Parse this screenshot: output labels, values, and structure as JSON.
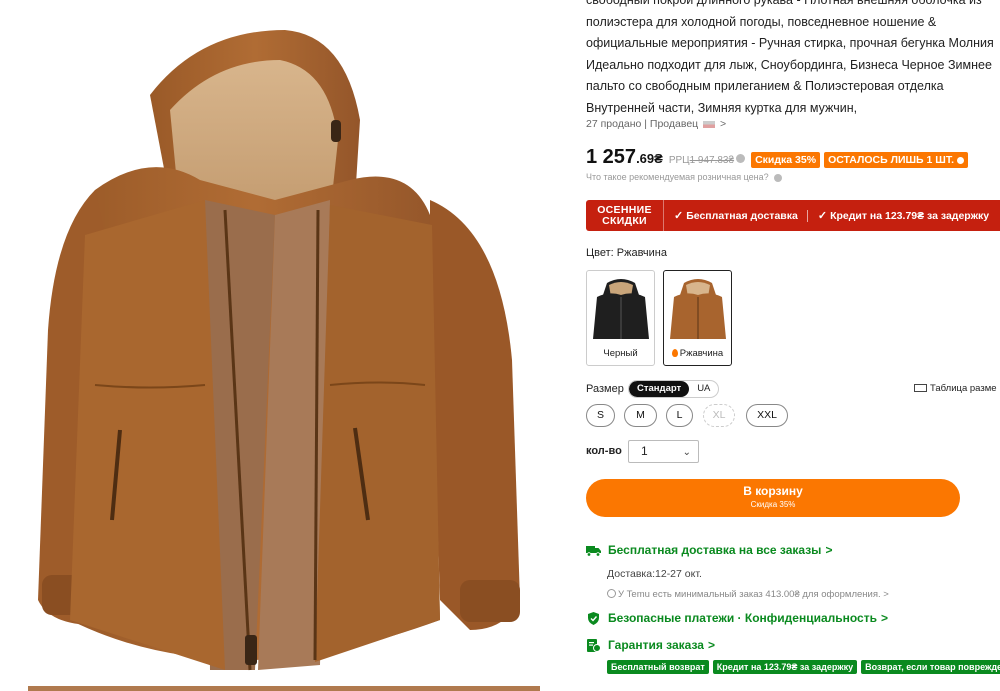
{
  "product": {
    "title_lines": [
      "свободный покрой длинного рукава - Плотная внешняя оболочка из",
      "полиэстера для холодной погоды, повседневное ношение &",
      "официальные мероприятия - Ручная стирка, прочная бегунка Молния",
      "Идеально подходит для лыж, Сноубординга, Бизнеса Черное Зимнее",
      "пальто со свободным прилеганием & Полиэстеровая отделка",
      "Внутренней части, Зимняя куртка для мужчин,"
    ],
    "sold": "27 продано",
    "separator": "|",
    "seller_label": "Продавец",
    "seller_chevron": ">"
  },
  "price": {
    "main": "1 257",
    "fraction": ".69₴",
    "rrp_label": "РРЦ",
    "rrp_old": "1 947.83₴",
    "discount_badge": "Скидка 35%",
    "stock_badge": "ОСТАЛОСЬ ЛИШЬ 1 ШТ.",
    "rrp_question": "Что такое рекомендуемая розничная цена?"
  },
  "promo": {
    "tag_line1": "ОСЕННИЕ",
    "tag_line2": "СКИДКИ",
    "free_shipping": "Бесплатная доставка",
    "credit": "Кредит на 123.79₴ за задержку",
    "check": "✓"
  },
  "color": {
    "label": "Цвет: Ржавчина",
    "options": [
      {
        "label": "Черный",
        "color": "#1f1f1f",
        "selected": false
      },
      {
        "label": "Ржавчина",
        "color": "#a8642e",
        "selected": true
      }
    ]
  },
  "size": {
    "label": "Размер",
    "standards": [
      "Стандарт",
      "UA"
    ],
    "active_standard": "Стандарт",
    "chart_label": "Таблица разме",
    "options": [
      {
        "label": "S",
        "available": true
      },
      {
        "label": "M",
        "available": true
      },
      {
        "label": "L",
        "available": true
      },
      {
        "label": "XL",
        "available": false
      },
      {
        "label": "XXL",
        "available": true
      }
    ]
  },
  "quantity": {
    "label": "кол-во",
    "value": "1",
    "chevron": "⌄"
  },
  "cart": {
    "label": "В корзину",
    "sublabel": "Скидка 35%"
  },
  "shipping": {
    "title": "Бесплатная доставка на все заказы",
    "delivery": "Доставка:12-27 окт.",
    "minimum": "У Temu есть минимальный заказ 413.00₴ для оформления.",
    "chevron": ">"
  },
  "security": {
    "title": "Безопасные платежи · Конфиденциальность"
  },
  "guarantee": {
    "title": "Гарантия заказа",
    "badges": [
      "Бесплатный возврат",
      "Кредит на 123.79₴ за задержку",
      "Возврат, если товар поврежден"
    ]
  },
  "colors": {
    "accent": "#fb7701",
    "promo_red": "#c5200f",
    "green": "#0a8a1f",
    "jacket": "#a8642e"
  }
}
